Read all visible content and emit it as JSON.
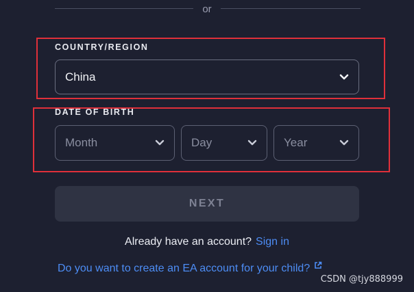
{
  "divider": {
    "text": "or"
  },
  "country": {
    "label": "COUNTRY/REGION",
    "value": "China"
  },
  "dob": {
    "label": "DATE OF BIRTH",
    "month_placeholder": "Month",
    "day_placeholder": "Day",
    "year_placeholder": "Year"
  },
  "actions": {
    "next_label": "NEXT"
  },
  "signin": {
    "prompt": "Already have an account?",
    "link": "Sign in"
  },
  "child": {
    "link": "Do you want to create an EA account for your child?"
  },
  "watermark": "CSDN @tjy888999",
  "colors": {
    "background": "#1d2030",
    "annotation": "#e0303a",
    "link": "#4d8df5",
    "button_bg": "#2f3343"
  },
  "icons": {
    "dropdown": "chevron-down-icon",
    "external": "external-link-icon"
  }
}
